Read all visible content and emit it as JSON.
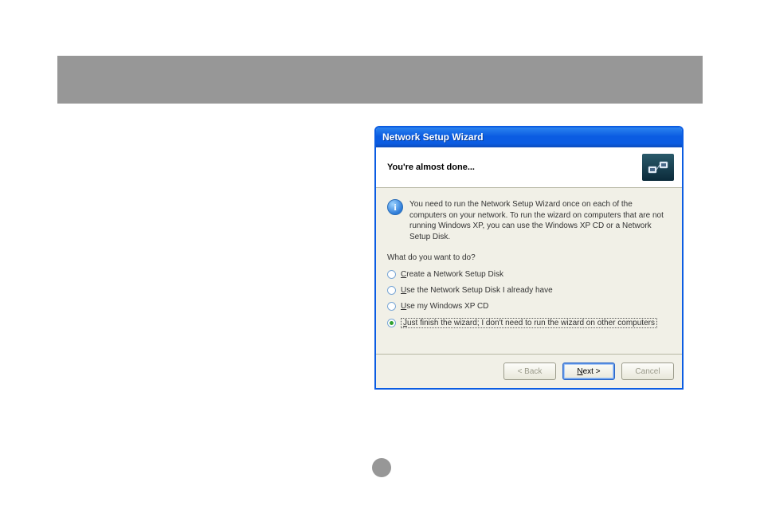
{
  "window": {
    "title": "Network Setup Wizard",
    "header_title": "You're almost done...",
    "info_text": "You need to run the Network Setup Wizard once on each of the computers on your network. To run the wizard on computers that are not running Windows XP, you can use the Windows XP CD or a Network Setup Disk.",
    "prompt": "What do you want to do?",
    "options": [
      {
        "prefix": "C",
        "rest": "reate a Network Setup Disk",
        "selected": false
      },
      {
        "prefix": "U",
        "rest": "se the Network Setup Disk I already have",
        "selected": false
      },
      {
        "prefix": "U",
        "rest": "se my Windows XP CD",
        "selected": false
      },
      {
        "prefix": "J",
        "rest": "ust finish the wizard; I don't need to run the wizard on other computers",
        "selected": true
      }
    ],
    "buttons": {
      "back": "< Back",
      "next_prefix": "N",
      "next_rest": "ext >",
      "cancel": "Cancel"
    }
  }
}
